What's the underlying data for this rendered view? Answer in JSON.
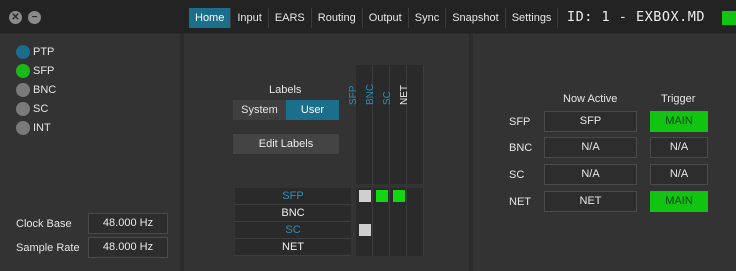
{
  "window": {
    "close_glyph": "✕",
    "min_glyph": "−"
  },
  "tabs": [
    {
      "label": "Home",
      "active": true
    },
    {
      "label": "Input"
    },
    {
      "label": "EARS"
    },
    {
      "label": "Routing"
    },
    {
      "label": "Output"
    },
    {
      "label": "Sync"
    },
    {
      "label": "Snapshot"
    },
    {
      "label": "Settings"
    }
  ],
  "device_id": "ID: 1 - EXBOX.MD",
  "clock_sources": [
    {
      "label": "PTP",
      "state": "blue"
    },
    {
      "label": "SFP",
      "state": "green"
    },
    {
      "label": "BNC",
      "state": "off"
    },
    {
      "label": "SC",
      "state": "off"
    },
    {
      "label": "INT",
      "state": "off"
    }
  ],
  "clock_base": {
    "label": "Clock Base",
    "value": "48.000 Hz"
  },
  "sample_rate": {
    "label": "Sample Rate",
    "value": "48.000 Hz"
  },
  "labels_section": {
    "title": "Labels",
    "system": "System",
    "user": "User",
    "edit_button": "Edit Labels"
  },
  "matrix": {
    "columns": [
      {
        "label": "SFP",
        "color": "#2a8fb8"
      },
      {
        "label": "BNC",
        "color": "#2a8fb8"
      },
      {
        "label": "SC",
        "color": "#2a8fb8"
      },
      {
        "label": "NET",
        "color": "#f0f0f0"
      }
    ],
    "rows": [
      {
        "label": "SFP",
        "color": "#2a8fb8"
      },
      {
        "label": "BNC",
        "color": "#f0f0f0"
      },
      {
        "label": "SC",
        "color": "#2a8fb8"
      },
      {
        "label": "NET",
        "color": "#f0f0f0"
      }
    ]
  },
  "sync_status": {
    "now_active_header": "Now Active",
    "trigger_header": "Trigger",
    "rows": [
      {
        "name": "SFP",
        "now_active": "SFP",
        "trigger": "MAIN",
        "trigger_on": true
      },
      {
        "name": "BNC",
        "now_active": "N/A",
        "trigger": "N/A",
        "trigger_on": false
      },
      {
        "name": "SC",
        "now_active": "N/A",
        "trigger": "N/A",
        "trigger_on": false
      },
      {
        "name": "NET",
        "now_active": "NET",
        "trigger": "MAIN",
        "trigger_on": true
      }
    ]
  },
  "colors": {
    "accent": "#1b6e8c",
    "led_green": "#11c411"
  }
}
